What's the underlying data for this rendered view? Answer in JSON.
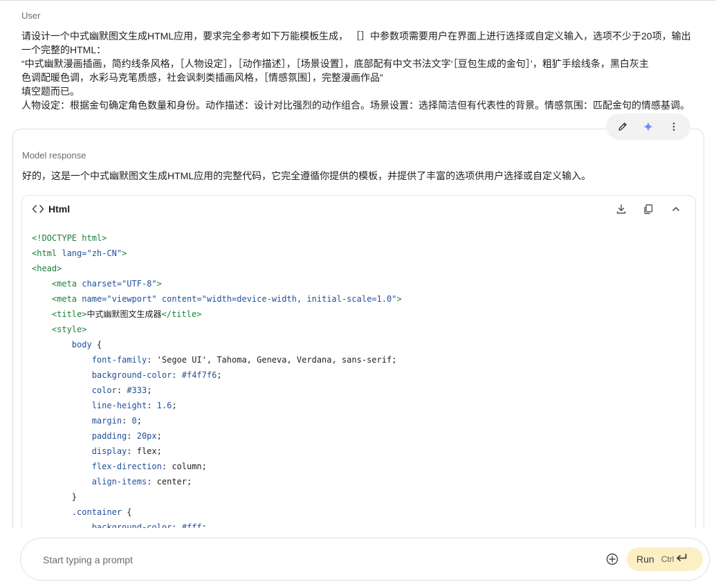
{
  "user_turn": {
    "role_label": "User",
    "lines": [
      "请设计一个中式幽默图文生成HTML应用，要求完全参考如下万能模板生成， ［］中参数项需要用户在界面上进行选择或自定义输入，选项不少于20项，输出",
      "一个完整的HTML：",
      "“中式幽默漫画插画，简约线条风格，［人物设定］，［动作描述］，［场景设置］，底部配有中文书法文字‘［豆包生成的金句］’，粗犷手绘线条，黑白灰主",
      "色调配暖色调，水彩马克笔质感，社会讽刺类插画风格，［情感氛围］，完整漫画作品”",
      "填空题而已。",
      "人物设定：根据金句确定角色数量和身份。动作描述：设计对比强烈的动作组合。场景设置：选择简洁但有代表性的背景。情感氛围：匹配金句的情感基调。"
    ]
  },
  "model_turn": {
    "role_label": "Model response",
    "intro": "好的，这是一个中式幽默图文生成HTML应用的完整代码，它完全遵循你提供的模板，并提供了丰富的选项供用户选择或自定义输入。",
    "code_block": {
      "language": "Html",
      "lines": [
        [
          {
            "t": "<!DOCTYPE html>",
            "c": "tag"
          }
        ],
        [
          {
            "t": "<html ",
            "c": "tag"
          },
          {
            "t": "lang=",
            "c": "attr"
          },
          {
            "t": "\"zh-CN\"",
            "c": "str"
          },
          {
            "t": ">",
            "c": "tag"
          }
        ],
        [
          {
            "t": "<head>",
            "c": "tag"
          }
        ],
        [
          {
            "t": "    "
          },
          {
            "t": "<meta ",
            "c": "tag"
          },
          {
            "t": "charset=",
            "c": "attr"
          },
          {
            "t": "\"UTF-8\"",
            "c": "str"
          },
          {
            "t": ">",
            "c": "tag"
          }
        ],
        [
          {
            "t": "    "
          },
          {
            "t": "<meta ",
            "c": "tag"
          },
          {
            "t": "name=",
            "c": "attr"
          },
          {
            "t": "\"viewport\" ",
            "c": "str"
          },
          {
            "t": "content=",
            "c": "attr"
          },
          {
            "t": "\"width=device-width, initial-scale=1.0\"",
            "c": "str"
          },
          {
            "t": ">",
            "c": "tag"
          }
        ],
        [
          {
            "t": "    "
          },
          {
            "t": "<title>",
            "c": "tag"
          },
          {
            "t": "中式幽默图文生成器",
            "c": "plain"
          },
          {
            "t": "</title>",
            "c": "tag"
          }
        ],
        [
          {
            "t": "    "
          },
          {
            "t": "<style>",
            "c": "tag"
          }
        ],
        [
          {
            "t": "        "
          },
          {
            "t": "body ",
            "c": "sel"
          },
          {
            "t": "{",
            "c": "plain"
          }
        ],
        [
          {
            "t": "            "
          },
          {
            "t": "font-family",
            "c": "prop"
          },
          {
            "t": ": ",
            "c": "plain"
          },
          {
            "t": "'Segoe UI', Tahoma, Geneva, Verdana, sans-serif",
            "c": "val"
          },
          {
            "t": ";",
            "c": "plain"
          }
        ],
        [
          {
            "t": "            "
          },
          {
            "t": "background-color",
            "c": "prop"
          },
          {
            "t": ": ",
            "c": "plain"
          },
          {
            "t": "#f4f7f6",
            "c": "str"
          },
          {
            "t": ";",
            "c": "plain"
          }
        ],
        [
          {
            "t": "            "
          },
          {
            "t": "color",
            "c": "prop"
          },
          {
            "t": ": ",
            "c": "plain"
          },
          {
            "t": "#333",
            "c": "str"
          },
          {
            "t": ";",
            "c": "plain"
          }
        ],
        [
          {
            "t": "            "
          },
          {
            "t": "line-height",
            "c": "prop"
          },
          {
            "t": ": ",
            "c": "plain"
          },
          {
            "t": "1.6",
            "c": "str"
          },
          {
            "t": ";",
            "c": "plain"
          }
        ],
        [
          {
            "t": "            "
          },
          {
            "t": "margin",
            "c": "prop"
          },
          {
            "t": ": ",
            "c": "plain"
          },
          {
            "t": "0",
            "c": "str"
          },
          {
            "t": ";",
            "c": "plain"
          }
        ],
        [
          {
            "t": "            "
          },
          {
            "t": "padding",
            "c": "prop"
          },
          {
            "t": ": ",
            "c": "plain"
          },
          {
            "t": "20px",
            "c": "str"
          },
          {
            "t": ";",
            "c": "plain"
          }
        ],
        [
          {
            "t": "            "
          },
          {
            "t": "display",
            "c": "prop"
          },
          {
            "t": ": ",
            "c": "plain"
          },
          {
            "t": "flex",
            "c": "val"
          },
          {
            "t": ";",
            "c": "plain"
          }
        ],
        [
          {
            "t": "            "
          },
          {
            "t": "flex-direction",
            "c": "prop"
          },
          {
            "t": ": ",
            "c": "plain"
          },
          {
            "t": "column",
            "c": "val"
          },
          {
            "t": ";",
            "c": "plain"
          }
        ],
        [
          {
            "t": "            "
          },
          {
            "t": "align-items",
            "c": "prop"
          },
          {
            "t": ": ",
            "c": "plain"
          },
          {
            "t": "center",
            "c": "val"
          },
          {
            "t": ";",
            "c": "plain"
          }
        ],
        [
          {
            "t": "        "
          },
          {
            "t": "}",
            "c": "plain"
          }
        ],
        [
          {
            "t": "        "
          },
          {
            "t": ".container ",
            "c": "sel"
          },
          {
            "t": "{",
            "c": "plain"
          }
        ],
        [
          {
            "t": "            "
          },
          {
            "t": "background-color",
            "c": "prop"
          },
          {
            "t": ": ",
            "c": "plain"
          },
          {
            "t": "#fff",
            "c": "str"
          },
          {
            "t": ";",
            "c": "plain"
          }
        ]
      ]
    }
  },
  "prompt_bar": {
    "placeholder": "Start typing a prompt",
    "run_label": "Run",
    "run_shortcut": "Ctrl"
  },
  "icons": {
    "edit": "pencil-icon",
    "rerun": "sparkle-icon",
    "more": "more-vert-icon",
    "code": "code-brackets-icon",
    "download": "download-icon",
    "copy": "copy-icon",
    "collapse": "chevron-up-icon",
    "add": "add-circle-icon",
    "enter": "enter-icon"
  },
  "colors": {
    "run_button_bg": "#fbefc3",
    "accent_blue": "#4c6ef5",
    "code_tag": "#1a7f37",
    "code_attr": "#1f4f99"
  }
}
